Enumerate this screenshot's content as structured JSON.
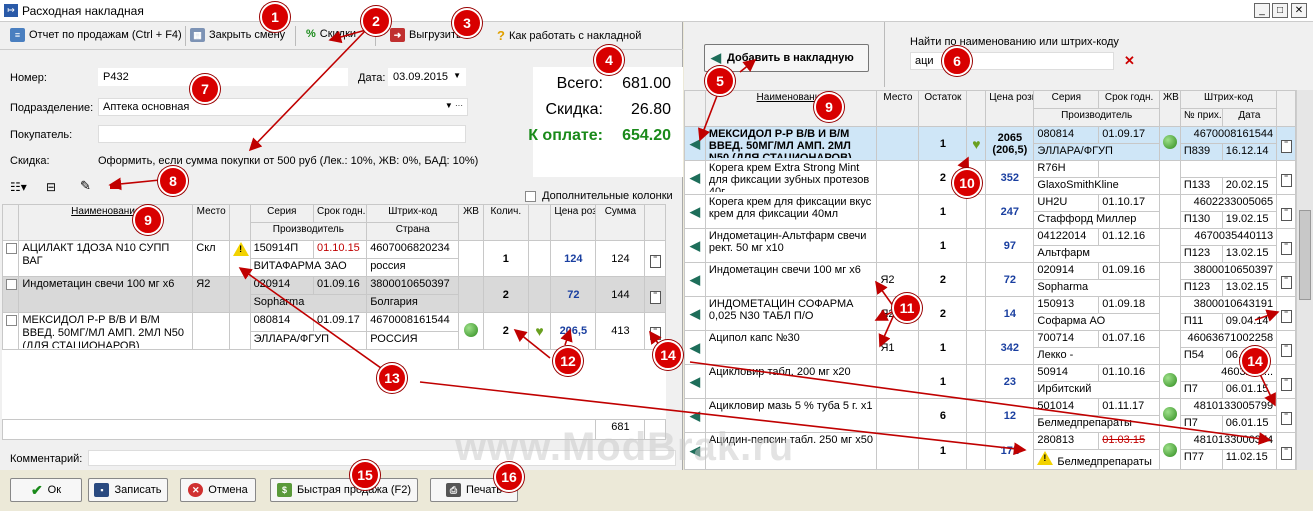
{
  "window": {
    "title": "Расходная накладная",
    "icon": "document-icon"
  },
  "toolbar": {
    "sales_report": "Отчет по продажам (Ctrl + F4)",
    "close_shift": "Закрыть смену",
    "discounts": "Скидки",
    "export": "Выгрузить",
    "help": "Как работать с накладной"
  },
  "form": {
    "number_label": "Номер:",
    "number_value": "Р432",
    "date_label": "Дата:",
    "date_value": "03.09.2015",
    "division_label": "Подразделение:",
    "division_value": "Аптека основная",
    "buyer_label": "Покупатель:",
    "buyer_value": "",
    "discount_label": "Скидка:",
    "discount_value": "Оформить, если сумма покупки от 500 руб  (Лек.: 10%, ЖВ: 0%, БАД: 10%)"
  },
  "totals": {
    "total_label": "Всего:",
    "total_value": "681.00",
    "discount_label": "Скидка:",
    "discount_value": "26.80",
    "pay_label": "К оплате:",
    "pay_value": "654.20",
    "pay_color": "#1a8a1a"
  },
  "left_grid": {
    "extra_columns": "Дополнительные колонки",
    "headers": {
      "name": "Наименование",
      "place": "Место",
      "series": "Серия",
      "expiry": "Срок годн.",
      "barcode": "Штрих-код",
      "manufacturer": "Производитель",
      "country": "Страна",
      "zhv": "ЖВ",
      "qty": "Колич.",
      "price": "Цена розн.",
      "sum": "Сумма"
    },
    "rows": [
      {
        "name": "АЦИЛАКТ 1ДОЗА N10 СУПП ВАГ",
        "place": "Скл",
        "series": "150914П",
        "expiry": "01.10.15",
        "barcode": "4607006820234",
        "manufacturer": "ВИТАФАРМА ЗАО",
        "country": "россия",
        "qty": "1",
        "price": "124",
        "sum": "124"
      },
      {
        "name": "Индометацин свечи 100 мг х6",
        "place": "Я2",
        "series": "020914",
        "expiry": "01.09.16",
        "barcode": "3800010650397",
        "manufacturer": "Sopharma",
        "country": "Болгария",
        "qty": "2",
        "price": "72",
        "sum": "144"
      },
      {
        "name": "МЕКСИДОЛ Р-Р В/В И В/М ВВЕД. 50МГ/МЛ АМП. 2МЛ N50 (ДЛЯ СТАЦИОНАРОВ)",
        "place": "",
        "series": "080814",
        "expiry": "01.09.17",
        "barcode": "4670008161544",
        "manufacturer": "ЭЛЛАРА/ФГУП",
        "country": "РОССИЯ",
        "qty": "2",
        "price": "206,5",
        "sum": "413"
      }
    ],
    "footer_sum": "681"
  },
  "comment_label": "Комментарий:",
  "right_panel": {
    "add_button": "Добавить в накладную",
    "search_label": "Найти по наименованию или штрих-коду",
    "search_value": "аци",
    "headers": {
      "name": "Наименование",
      "place": "Место",
      "stock": "Остаток",
      "price": "Цена розн.",
      "series": "Серия",
      "expiry": "Срок годн.",
      "manufacturer": "Производитель",
      "zhv": "ЖВ",
      "barcode": "Штрих-код",
      "income_no": "№ прих.",
      "date": "Дата"
    },
    "rows": [
      {
        "name": "МЕКСИДОЛ Р-Р В/В И В/М ВВЕД. 50МГ/МЛ АМП. 2МЛ N50 (ДЛЯ СТАЦИОНАРОВ)",
        "place": "",
        "stock": "1",
        "price": "2065 (206,5)",
        "series": "080814",
        "expiry": "01.09.17",
        "manufacturer": "ЭЛЛАРА/ФГУП",
        "barcode": "4670008161544",
        "income_no": "П839",
        "date": "16.12.14",
        "zhv": true,
        "heart": true,
        "selected": true
      },
      {
        "name": "Корега крем  Extra Strong Mint для фиксации зубных протезов 40г",
        "place": "",
        "stock": "2",
        "price": "352",
        "series": "R76H",
        "expiry": "",
        "manufacturer": "GlaxoSmithKline",
        "barcode": "",
        "income_no": "П133",
        "date": "20.02.15"
      },
      {
        "name": "Корега крем для фиксации  вкус крем для фиксации 40мл",
        "place": "",
        "stock": "1",
        "price": "247",
        "series": "UH2U",
        "expiry": "01.10.17",
        "manufacturer": "Стаффорд Миллер",
        "barcode": "4602233005065",
        "income_no": "П130",
        "date": "19.02.15"
      },
      {
        "name": "Индометацин-Альтфарм свечи рект. 50 мг х10",
        "place": "",
        "stock": "1",
        "price": "97",
        "series": "04122014",
        "expiry": "01.12.16",
        "manufacturer": "Альтфарм",
        "barcode": "4670035440113",
        "income_no": "П123",
        "date": "13.02.15"
      },
      {
        "name": "Индометацин свечи 100 мг х6",
        "place": "Я2",
        "stock": "2",
        "price": "72",
        "series": "020914",
        "expiry": "01.09.16",
        "manufacturer": "Sopharma",
        "barcode": "3800010650397",
        "income_no": "П123",
        "date": "13.02.15"
      },
      {
        "name": "ИНДОМЕТАЦИН СОФАРМА 0,025 N30 ТАБЛ П/О",
        "place": "Я2",
        "stock": "2",
        "price": "14",
        "series": "150913",
        "expiry": "01.09.18",
        "manufacturer": "Софарма АО",
        "barcode": "3800010643191",
        "income_no": "П11",
        "date": "09.04.14"
      },
      {
        "name": "Аципол капс №30",
        "place": "Я1",
        "stock": "1",
        "price": "342",
        "series": "700714",
        "expiry": "01.07.16",
        "manufacturer": "Лекко -",
        "barcode": "46063671002258",
        "income_no": "П54",
        "date": "06.01.15"
      },
      {
        "name": "Ацикловир табл. 200 мг х20",
        "place": "",
        "stock": "1",
        "price": "23",
        "series": "50914",
        "expiry": "01.10.16",
        "manufacturer": "Ирбитский",
        "barcode": "4603276...",
        "income_no": "П7",
        "date": "06.01.15",
        "zhv": true
      },
      {
        "name": "Ацикловир мазь 5 % туба 5 г. х1",
        "place": "",
        "stock": "6",
        "price": "12",
        "series": "501014",
        "expiry": "01.11.17",
        "manufacturer": "Белмедпрепараты",
        "barcode": "4810133005799",
        "income_no": "П7",
        "date": "06.01.15",
        "zhv": true
      },
      {
        "name": "Ацидин-пепсин табл. 250 мг х50",
        "place": "",
        "stock": "1",
        "price": "172",
        "series": "280813",
        "expiry": "01.03.15",
        "manufacturer": "Белмедпрепараты",
        "barcode": "4810133000374",
        "income_no": "П77",
        "date": "11.02.15",
        "zhv": true,
        "warn": true
      }
    ]
  },
  "bottom": {
    "ok": "Ок",
    "save": "Записать",
    "cancel": "Отмена",
    "quick_sale": "Быстрая продажа (F2)",
    "print": "Печать"
  },
  "watermark": "www.ModBrak.ru",
  "callouts": [
    "1",
    "2",
    "3",
    "4",
    "5",
    "6",
    "7",
    "8",
    "9",
    "9",
    "10",
    "11",
    "12",
    "13",
    "14",
    "14",
    "15",
    "16"
  ]
}
